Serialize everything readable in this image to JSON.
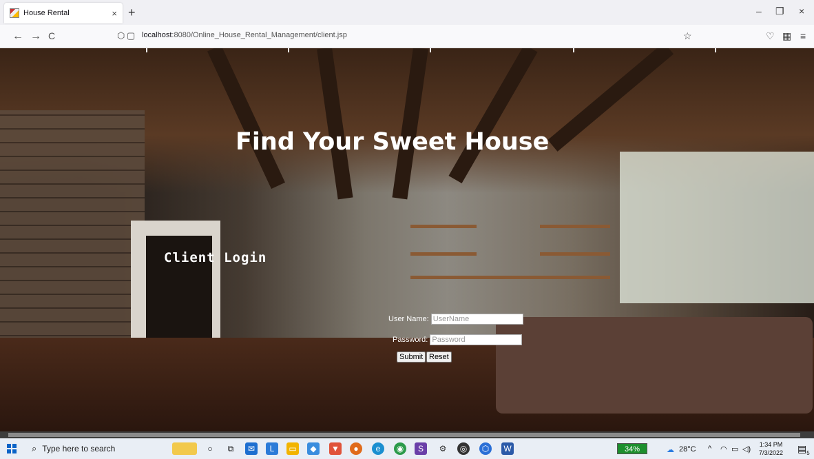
{
  "browser": {
    "tab_title": "House Rental",
    "tab_close": "×",
    "new_tab": "+",
    "url_host": "localhost",
    "url_rest": ":8080/Online_House_Rental_Management/client.jsp",
    "back": "←",
    "forward": "→",
    "reload": "C",
    "window_min": "–",
    "window_restore": "❐",
    "window_close": "×",
    "bookmark_star": "☆",
    "pocket": "♡",
    "menu": "≡"
  },
  "page": {
    "headline": "Find Your Sweet House",
    "login_title": "Client Login",
    "form": {
      "username_label": "User Name:",
      "username_placeholder": "UserName",
      "password_label": "Password:",
      "password_placeholder": "Password",
      "submit_label": "Submit",
      "reset_label": "Reset"
    }
  },
  "taskbar": {
    "search_placeholder": "Type here to search",
    "battery": "34%",
    "temperature": "28°C",
    "time": "1:34 PM",
    "date": "7/3/2022",
    "notifications": "5"
  }
}
